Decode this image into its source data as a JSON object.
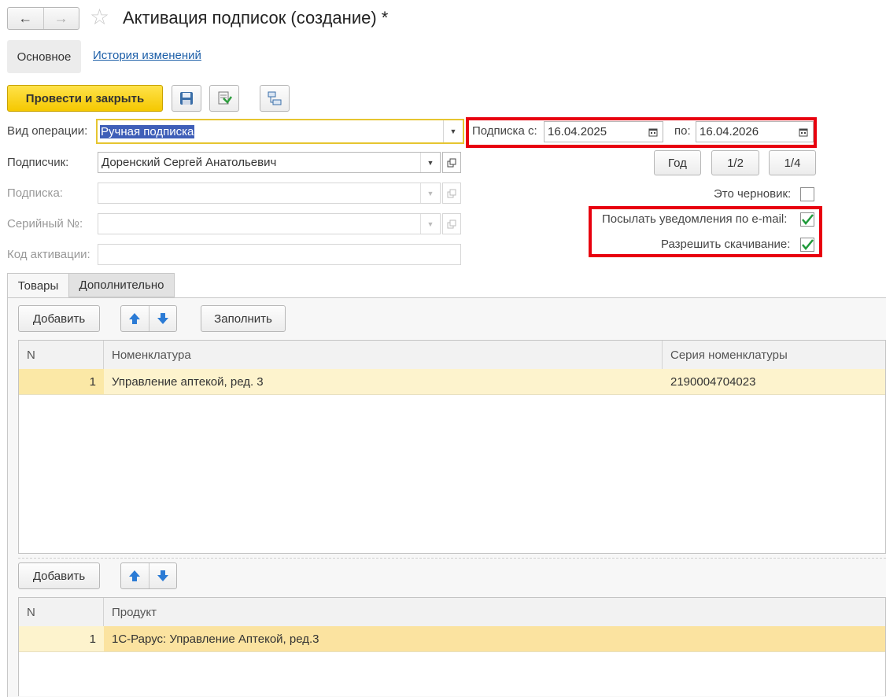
{
  "window": {
    "title": "Активация подписок (создание) *",
    "tabs": {
      "main": "Основное",
      "history": "История изменений"
    }
  },
  "toolbar": {
    "post_close": "Провести и закрыть"
  },
  "form": {
    "operation_label": "Вид операции:",
    "operation_value": "Ручная подписка",
    "subscriber_label": "Подписчик:",
    "subscriber_value": "Доренский Сергей Анатольевич",
    "subscription_label": "Подписка:",
    "serial_label": "Серийный №:",
    "activation_label": "Код активации:",
    "sub_from_label": "Подписка с:",
    "sub_from_value": "16.04.2025",
    "sub_to_label": "по:",
    "sub_to_value": "16.04.2026",
    "period_buttons": {
      "year": "Год",
      "half": "1/2",
      "quarter": "1/4"
    },
    "draft_label": "Это черновик:",
    "draft_checked": false,
    "email_label": "Посылать уведомления по e-mail:",
    "email_checked": true,
    "download_label": "Разрешить скачивание:",
    "download_checked": true
  },
  "lower_tabs": {
    "goods": "Товары",
    "extra": "Дополнительно"
  },
  "goods_table": {
    "add": "Добавить",
    "fill": "Заполнить",
    "columns": [
      "N",
      "Номенклатура",
      "Серия номенклатуры"
    ],
    "rows": [
      [
        "1",
        "Управление аптекой, ред. 3",
        "2190004704023"
      ]
    ]
  },
  "products_table": {
    "add": "Добавить",
    "columns": [
      "N",
      "Продукт"
    ],
    "rows": [
      [
        "1",
        "1С-Рарус: Управление Аптекой, ред.3"
      ]
    ]
  },
  "colors": {
    "accent_yellow": "#f5c800",
    "highlight_red": "#e8000e",
    "row_highlight": "#fdf3cd",
    "check_green": "#1f9a3a"
  }
}
